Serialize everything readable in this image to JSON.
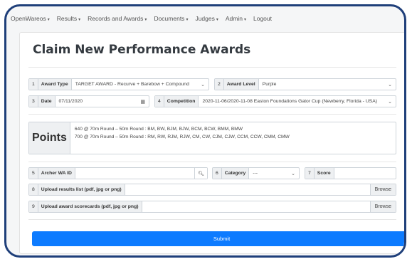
{
  "navbar": {
    "items": [
      {
        "label": "OpenWareos",
        "caret": "▾"
      },
      {
        "label": "Results",
        "caret": "▾"
      },
      {
        "label": "Records and Awards",
        "caret": "▾"
      },
      {
        "label": "Documents",
        "caret": "▾"
      },
      {
        "label": "Judges",
        "caret": "▾"
      },
      {
        "label": "Admin",
        "caret": "▾"
      },
      {
        "label": "Logout",
        "caret": ""
      }
    ]
  },
  "page": {
    "title": "Claim New Performance Awards"
  },
  "form": {
    "award_type": {
      "num": "1",
      "label": "Award Type",
      "value": "TARGET AWARD - Recurve + Barebow + Compound"
    },
    "award_level": {
      "num": "2",
      "label": "Award Level",
      "value": "Purple"
    },
    "date": {
      "num": "3",
      "label": "Date",
      "value": "07/11/2020"
    },
    "competition": {
      "num": "4",
      "label": "Competition",
      "value": "2020-11-06/2020-11-08 Easton Foundations Gator Cup (Newberry, Florida - USA)"
    },
    "points": {
      "label": "Points",
      "lines": [
        "640 @ 70m Round – 50m Round : BM, BW, BJM, BJW, BCM, BCW, BMM, BMW",
        "700 @ 70m Round – 50m Round : RM, RW, RJM, RJW, CM, CW, CJM, CJW, CCM, CCW, CMM, CMW"
      ]
    },
    "archer_id": {
      "num": "5",
      "label": "Archer WA ID",
      "value": ""
    },
    "category": {
      "num": "6",
      "label": "Category",
      "value": "---"
    },
    "score": {
      "num": "7",
      "label": "Score",
      "value": ""
    },
    "upload_results": {
      "num": "8",
      "label": "Upload results list (pdf, jpg or png)",
      "browse": "Browse"
    },
    "upload_scorecards": {
      "num": "9",
      "label": "Upload award scorecards (pdf, jpg or png)",
      "browse": "Browse"
    },
    "submit_label": "Submit"
  },
  "icons": {
    "search": "search-icon",
    "calendar": "calendar-icon",
    "chevron": "chevron-down-icon"
  },
  "colors": {
    "primary": "#0d7bff",
    "frame_border": "#1f3f7a"
  }
}
